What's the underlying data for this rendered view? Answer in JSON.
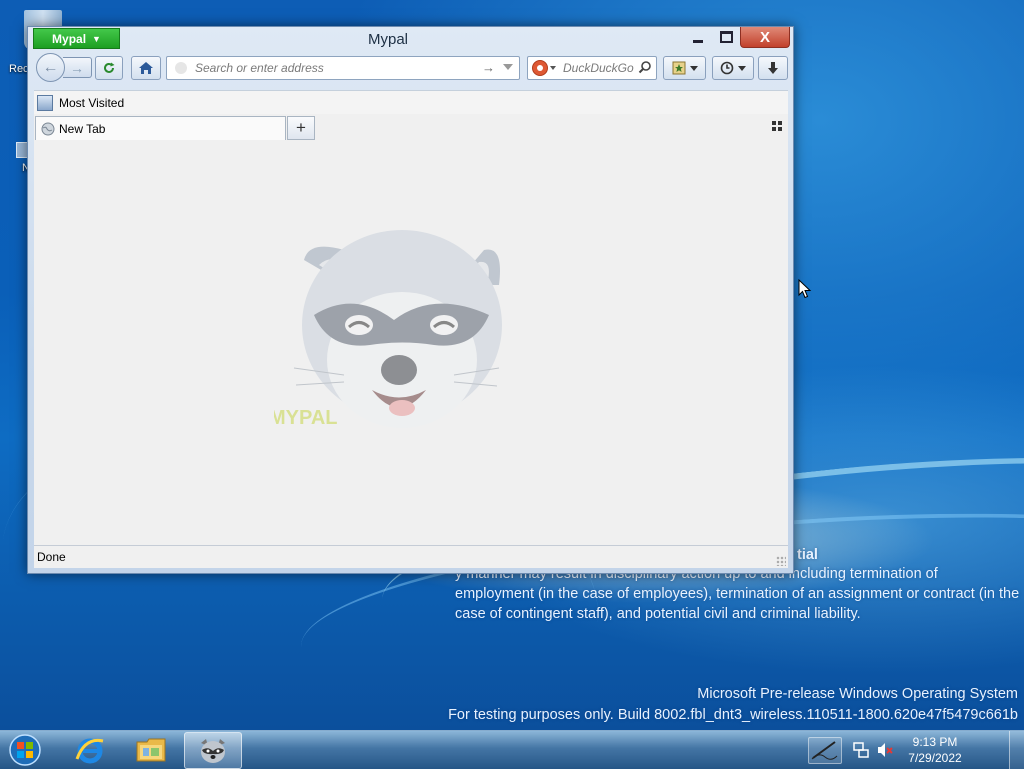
{
  "desktop": {
    "icons": [
      {
        "label": "Rec"
      },
      {
        "label": "N"
      }
    ],
    "notice": {
      "heading": "tial",
      "body": "y manner may result in disciplinary action up to and including termination of employment (in the case of employees), termination of an assignment or contract (in the case of contingent staff), and potential civil and criminal liability."
    },
    "build": {
      "line1": "Microsoft Pre-release Windows Operating System",
      "line2": "For testing purposes only. Build 8002.fbl_dnt3_wireless.110511-1800.620e47f5479c661b"
    }
  },
  "window": {
    "title": "Mypal",
    "menu_button_label": "Mypal",
    "close_glyph": "X"
  },
  "toolbar": {
    "address_placeholder": "Search or enter address",
    "search_placeholder": "DuckDuckGo"
  },
  "bookmarks": {
    "items": [
      {
        "label": "Most Visited"
      }
    ]
  },
  "tabs": [
    {
      "label": "New Tab",
      "active": true
    }
  ],
  "content": {
    "logo_text": "MYPAL"
  },
  "status": {
    "text": "Done"
  },
  "taskbar": {
    "items": [
      {
        "name": "Internet Explorer",
        "icon": "ie-icon"
      },
      {
        "name": "Windows Explorer",
        "icon": "folder-icon"
      },
      {
        "name": "Mypal",
        "icon": "raccoon-icon",
        "active": true
      }
    ],
    "clock": {
      "time": "9:13 PM",
      "date": "7/29/2022"
    }
  },
  "colors": {
    "menu_button": "#2db534",
    "close_button": "#c2412c",
    "desktop_blue": "#0d5db5"
  }
}
